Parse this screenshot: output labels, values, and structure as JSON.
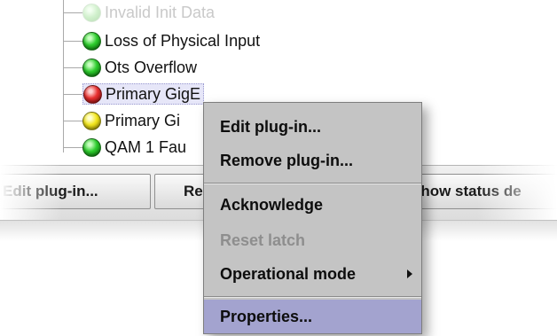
{
  "tree": {
    "items": [
      {
        "label": "Invalid Init Data",
        "status": "faded"
      },
      {
        "label": "Loss of Physical Input",
        "status": "green"
      },
      {
        "label": "Ots Overflow",
        "status": "green"
      },
      {
        "label": "Primary GigE",
        "status": "red"
      },
      {
        "label": "Primary Gi",
        "status": "yellow"
      },
      {
        "label": "QAM 1 Fau",
        "status": "green"
      }
    ]
  },
  "button_bar": {
    "edit_plugin": "Edit plug-in...",
    "remove_plugin": "Re",
    "show_status": "Show status de"
  },
  "context_menu": {
    "edit_plugin": "Edit plug-in...",
    "remove_plugin": "Remove plug-in...",
    "acknowledge": "Acknowledge",
    "reset_latch": "Reset latch",
    "operational_mode": "Operational mode",
    "properties": "Properties..."
  },
  "colors": {
    "menu_bg": "#c4c4c4",
    "menu_highlight": "#a3a3cf",
    "led_green": "#2ecc2e",
    "led_red": "#e83030",
    "led_yellow": "#f2e61e"
  }
}
